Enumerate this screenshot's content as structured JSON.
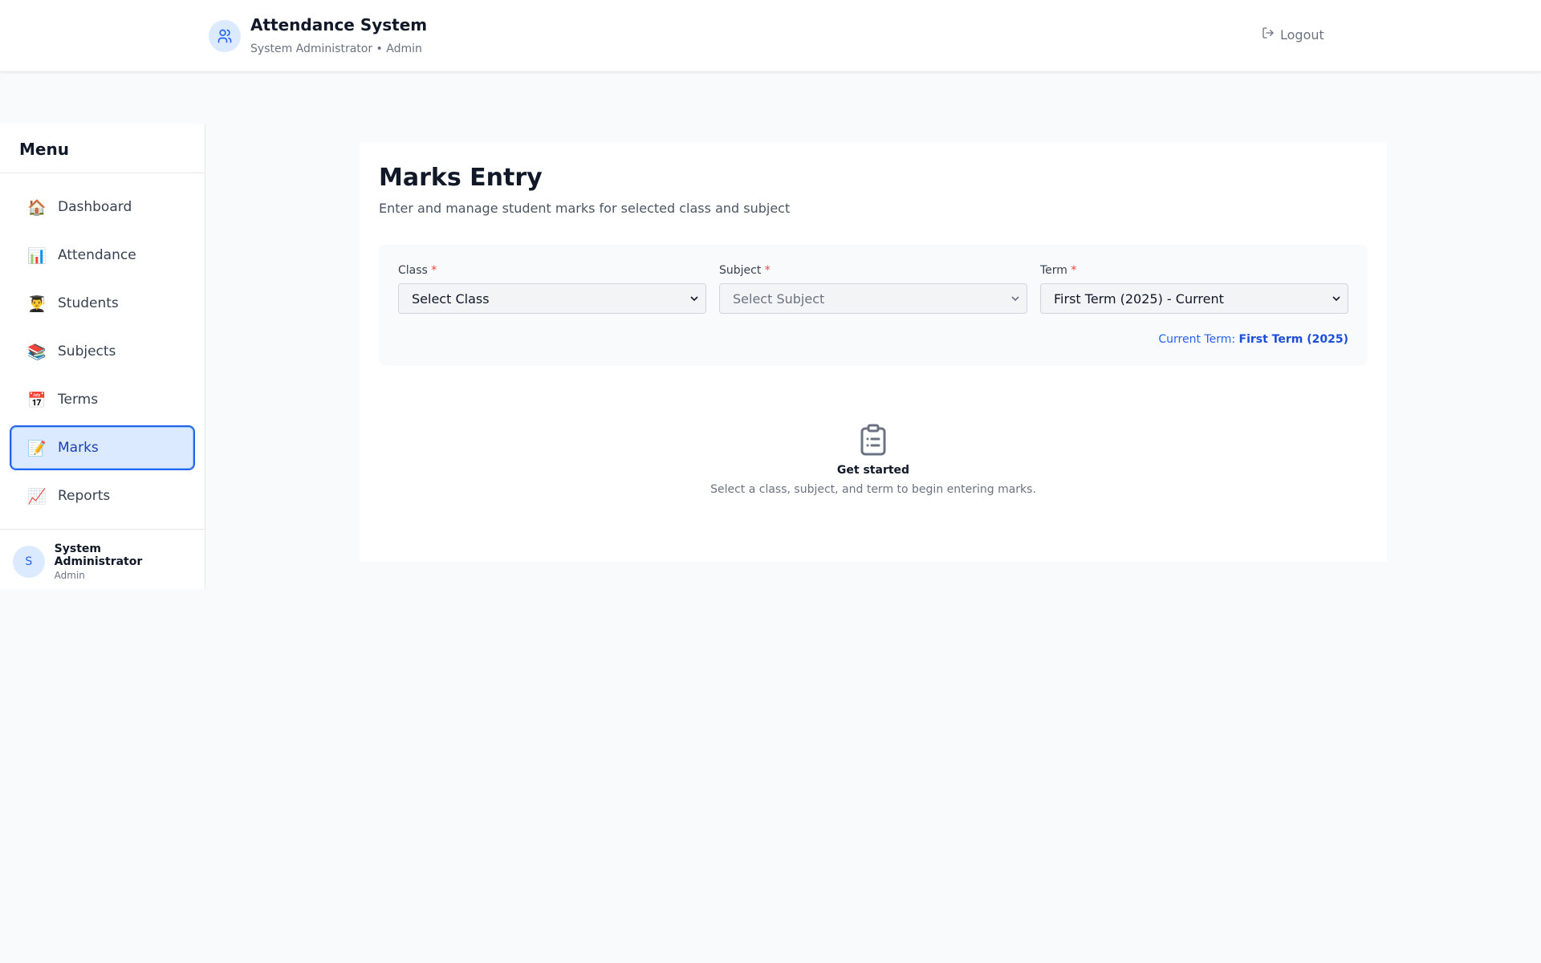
{
  "header": {
    "title": "Attendance System",
    "subtitle": "System Administrator • Admin",
    "logout_label": "Logout",
    "brand_icon": "users-icon",
    "logout_icon": "logout-icon"
  },
  "sidebar": {
    "title": "Menu",
    "items": [
      {
        "icon": "🏠",
        "label": "Dashboard",
        "active": false
      },
      {
        "icon": "📊",
        "label": "Attendance",
        "active": false
      },
      {
        "icon": "👨‍🎓",
        "label": "Students",
        "active": false
      },
      {
        "icon": "📚",
        "label": "Subjects",
        "active": false
      },
      {
        "icon": "📅",
        "label": "Terms",
        "active": false
      },
      {
        "icon": "📝",
        "label": "Marks",
        "active": true
      },
      {
        "icon": "📈",
        "label": "Reports",
        "active": false
      }
    ],
    "user": {
      "initial": "S",
      "name": "System Administrator",
      "role": "Admin"
    }
  },
  "main": {
    "title": "Marks Entry",
    "subtitle": "Enter and manage student marks for selected class and subject",
    "filters": {
      "class": {
        "label": "Class",
        "required": "*",
        "value": "Select Class"
      },
      "subject": {
        "label": "Subject",
        "required": "*",
        "value": "Select Subject"
      },
      "term": {
        "label": "Term",
        "required": "*",
        "value": "First Term (2025) - Current"
      }
    },
    "current_term_label": "Current Term:",
    "current_term_value": "First Term (2025)",
    "empty_state": {
      "icon": "clipboard-icon",
      "title": "Get started",
      "text": "Select a class, subject, and term to begin entering marks."
    }
  },
  "colors": {
    "accent": "#2563eb",
    "active_bg": "#dbeafe",
    "required": "#ef4444"
  }
}
